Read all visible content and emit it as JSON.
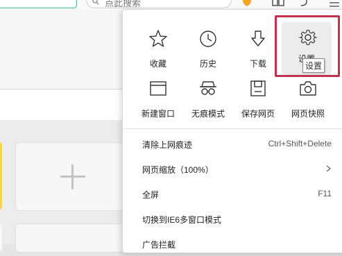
{
  "browser": {
    "search_text": "点此搜索",
    "accent": "#4db38c"
  },
  "menu": {
    "grid": [
      {
        "label": "收藏",
        "icon": "star-icon"
      },
      {
        "label": "历史",
        "icon": "clock-icon"
      },
      {
        "label": "下载",
        "icon": "download-icon"
      },
      {
        "label": "设置",
        "icon": "gear-icon"
      },
      {
        "label": "新建窗口",
        "icon": "new-window-icon"
      },
      {
        "label": "无痕模式",
        "icon": "incognito-glasses-icon"
      },
      {
        "label": "保存网页",
        "icon": "save-page-icon"
      },
      {
        "label": "网页快照",
        "icon": "camera-icon"
      }
    ],
    "tooltip": "设置",
    "items": [
      {
        "label": "清除上网痕迹",
        "shortcut": "Ctrl+Shift+Delete"
      },
      {
        "label": "网页缩放（100%）",
        "has_submenu": true
      },
      {
        "label": "全屏",
        "shortcut": "F11"
      },
      {
        "label": "切换到IE6多窗口模式"
      },
      {
        "label": "广告拦截"
      }
    ],
    "highlight_color": "#c0334a"
  },
  "new_tab": {
    "add_tile_icon": "plus-icon"
  }
}
